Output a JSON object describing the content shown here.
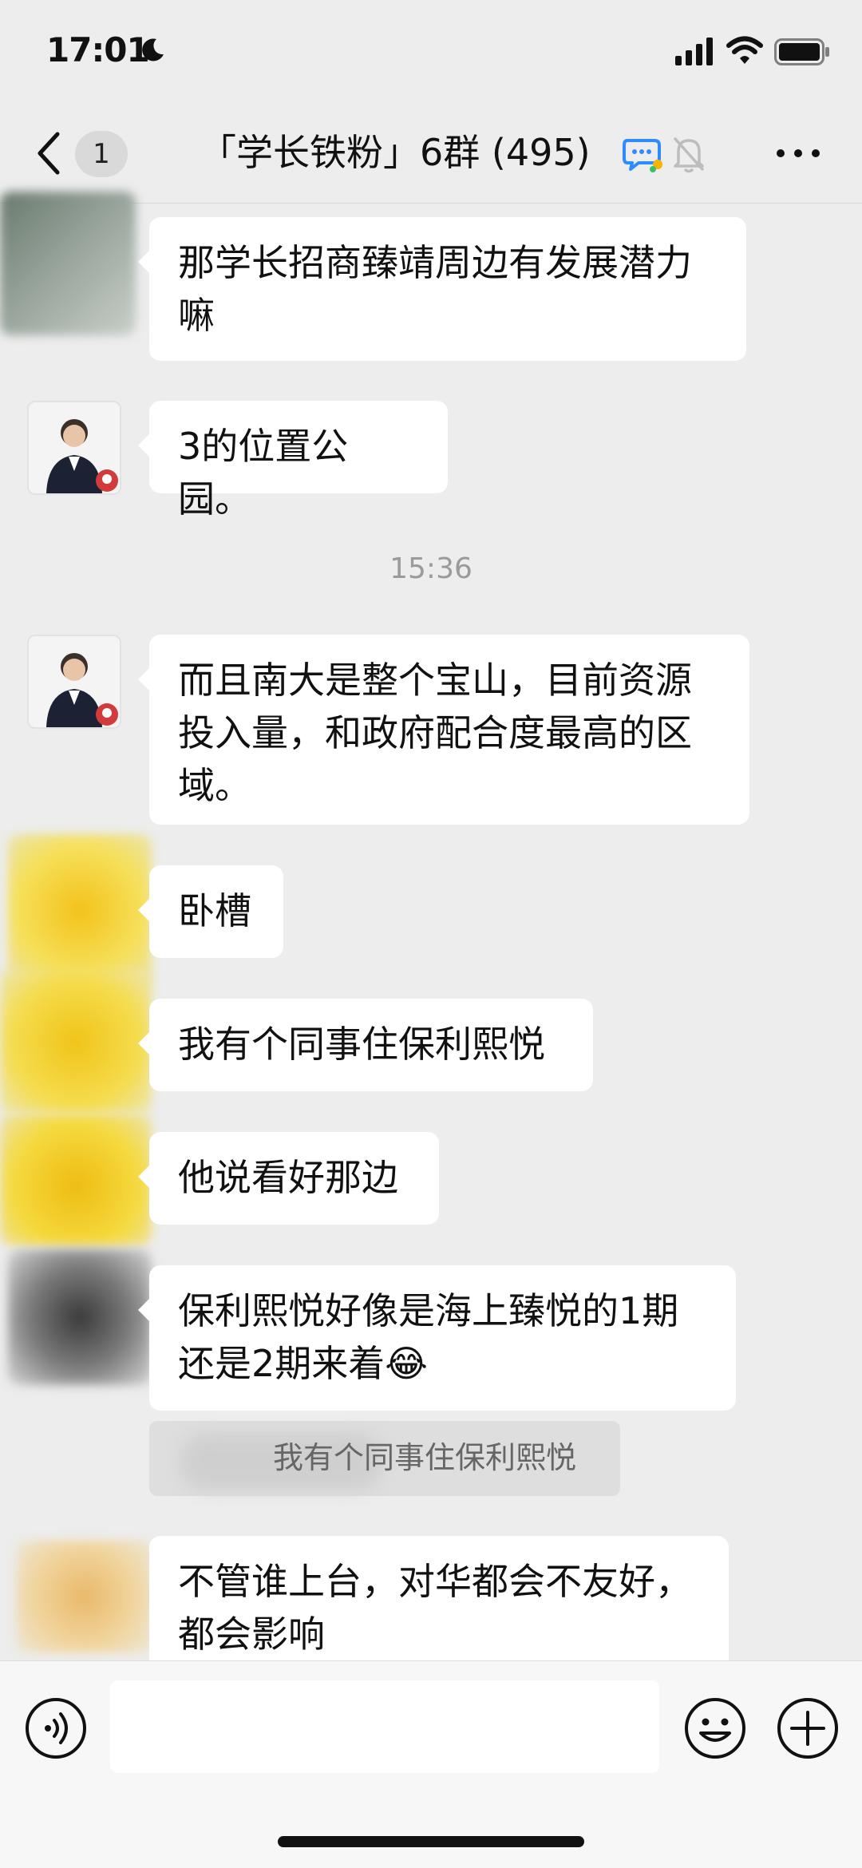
{
  "status_bar": {
    "time": "17:01"
  },
  "header": {
    "back_count": "1",
    "title": "「学长铁粉」6群 (495)"
  },
  "messages": [
    {
      "text": "那学长招商臻靖周边有发展潜力嘛"
    },
    {
      "text": "3的位置公园。"
    },
    {
      "text": "而且南大是整个宝山，目前资源投入量，和政府配合度最高的区域。"
    },
    {
      "text": "卧槽"
    },
    {
      "text": "我有个同事住保利熙悦"
    },
    {
      "text": "他说看好那边"
    },
    {
      "text": "保利熙悦好像是海上臻悦的1期还是2期来着😂"
    },
    {
      "text": "不管谁上台，对华都会不友好，都会影响"
    }
  ],
  "timestamp": "15:36",
  "quote": {
    "text": "我有个同事住保利熙悦"
  },
  "colors": {
    "background": "#ededed",
    "bubble": "#ffffff",
    "accent_chat_icon": "#2f8cff"
  }
}
